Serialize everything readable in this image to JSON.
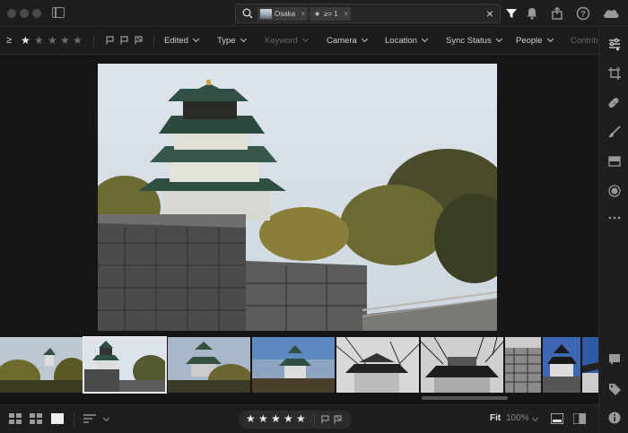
{
  "search": {
    "chips": [
      {
        "label": "Osaka",
        "remove": "×"
      },
      {
        "label": "≥= 1",
        "remove": "×"
      }
    ],
    "clear": "×"
  },
  "filterbar": {
    "rating_operator": "≥",
    "rating_stars": 5,
    "rating_value": 1,
    "filters": [
      {
        "label": "Edited",
        "enabled": true
      },
      {
        "label": "Type",
        "enabled": true
      },
      {
        "label": "Keyword",
        "enabled": false
      },
      {
        "label": "Camera",
        "enabled": true
      },
      {
        "label": "Location",
        "enabled": true
      },
      {
        "label": "Sync Status",
        "enabled": true
      },
      {
        "label": "People",
        "enabled": true
      },
      {
        "label": "Contrib",
        "enabled": false
      }
    ]
  },
  "bottombar": {
    "fit_label": "Fit",
    "zoom_label": "100%",
    "rating_stars": 5
  },
  "filmstrip": {
    "selected_index": 1,
    "count": 8
  },
  "colors": {
    "background": "#161616",
    "panel": "#1e1e1e",
    "selection": "#e8e8e8"
  }
}
